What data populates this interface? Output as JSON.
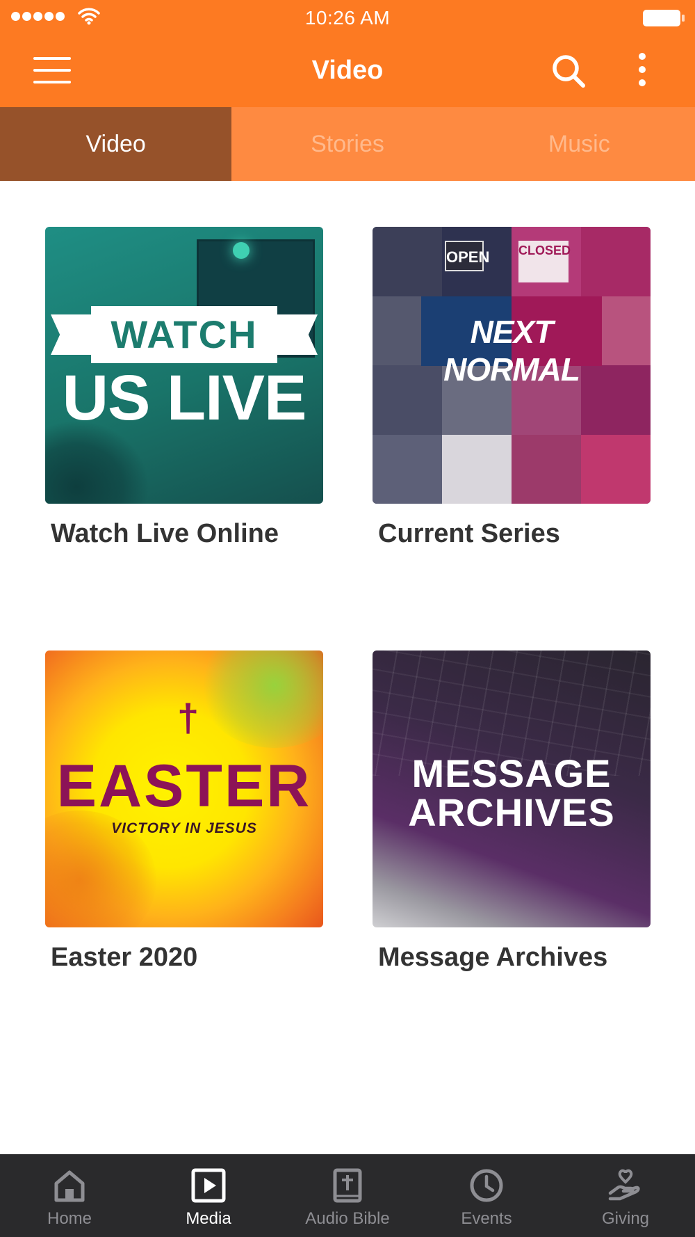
{
  "status_bar": {
    "time": "10:26 AM"
  },
  "header": {
    "title": "Video"
  },
  "tabs": [
    {
      "label": "Video",
      "active": true
    },
    {
      "label": "Stories",
      "active": false
    },
    {
      "label": "Music",
      "active": false
    }
  ],
  "cards": [
    {
      "title": "Watch Live Online",
      "thumbnail": {
        "banner_word": "WATCH",
        "big_text": "US LIVE"
      }
    },
    {
      "title": "Current Series",
      "thumbnail": {
        "title": "NEXT NORMAL",
        "sign_open": "OPEN",
        "sign_closed": "CLOSED"
      }
    },
    {
      "title": "Easter 2020",
      "thumbnail": {
        "cross": "†",
        "word": "EASTER",
        "subtitle": "VICTORY IN JESUS"
      }
    },
    {
      "title": "Message Archives",
      "thumbnail": {
        "line1": "MESSAGE",
        "line2": "ARCHIVES"
      }
    }
  ],
  "bottom_nav": [
    {
      "label": "Home",
      "icon": "home-icon",
      "active": false
    },
    {
      "label": "Media",
      "icon": "play-icon",
      "active": true
    },
    {
      "label": "Audio Bible",
      "icon": "bible-icon",
      "active": false
    },
    {
      "label": "Events",
      "icon": "clock-icon",
      "active": false
    },
    {
      "label": "Giving",
      "icon": "giving-icon",
      "active": false
    }
  ],
  "colors": {
    "primary": "#FD7A22",
    "tab_bar": "#FE8A41",
    "tab_active": "#96522A",
    "nav_bg": "#2A2A2C"
  }
}
